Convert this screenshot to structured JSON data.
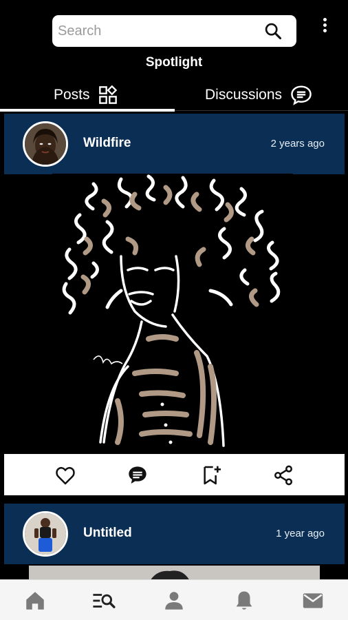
{
  "search": {
    "placeholder": "Search"
  },
  "header": {
    "title": "Spotlight"
  },
  "tabs": [
    {
      "label": "Posts",
      "icon": "grid-plus-icon",
      "active": true
    },
    {
      "label": "Discussions",
      "icon": "chat-bubble-icon",
      "active": false
    }
  ],
  "posts": [
    {
      "title": "Wildfire",
      "time": "2 years ago",
      "image": "line-art portrait of a woman with curly hair on black background"
    },
    {
      "title": "Untitled",
      "time": "1 year ago"
    }
  ],
  "actions": [
    "heart-icon",
    "comment-icon",
    "bookmark-add-icon",
    "share-icon"
  ],
  "bottom_nav": [
    "home-icon",
    "search-list-icon",
    "profile-icon",
    "notifications-icon",
    "mail-icon"
  ],
  "colors": {
    "header_bg": "#0b2e55",
    "background": "#000000",
    "nav_bg": "#f5f5f5",
    "icon_gray": "#7a7a7a",
    "art_tan": "#b09a86"
  }
}
